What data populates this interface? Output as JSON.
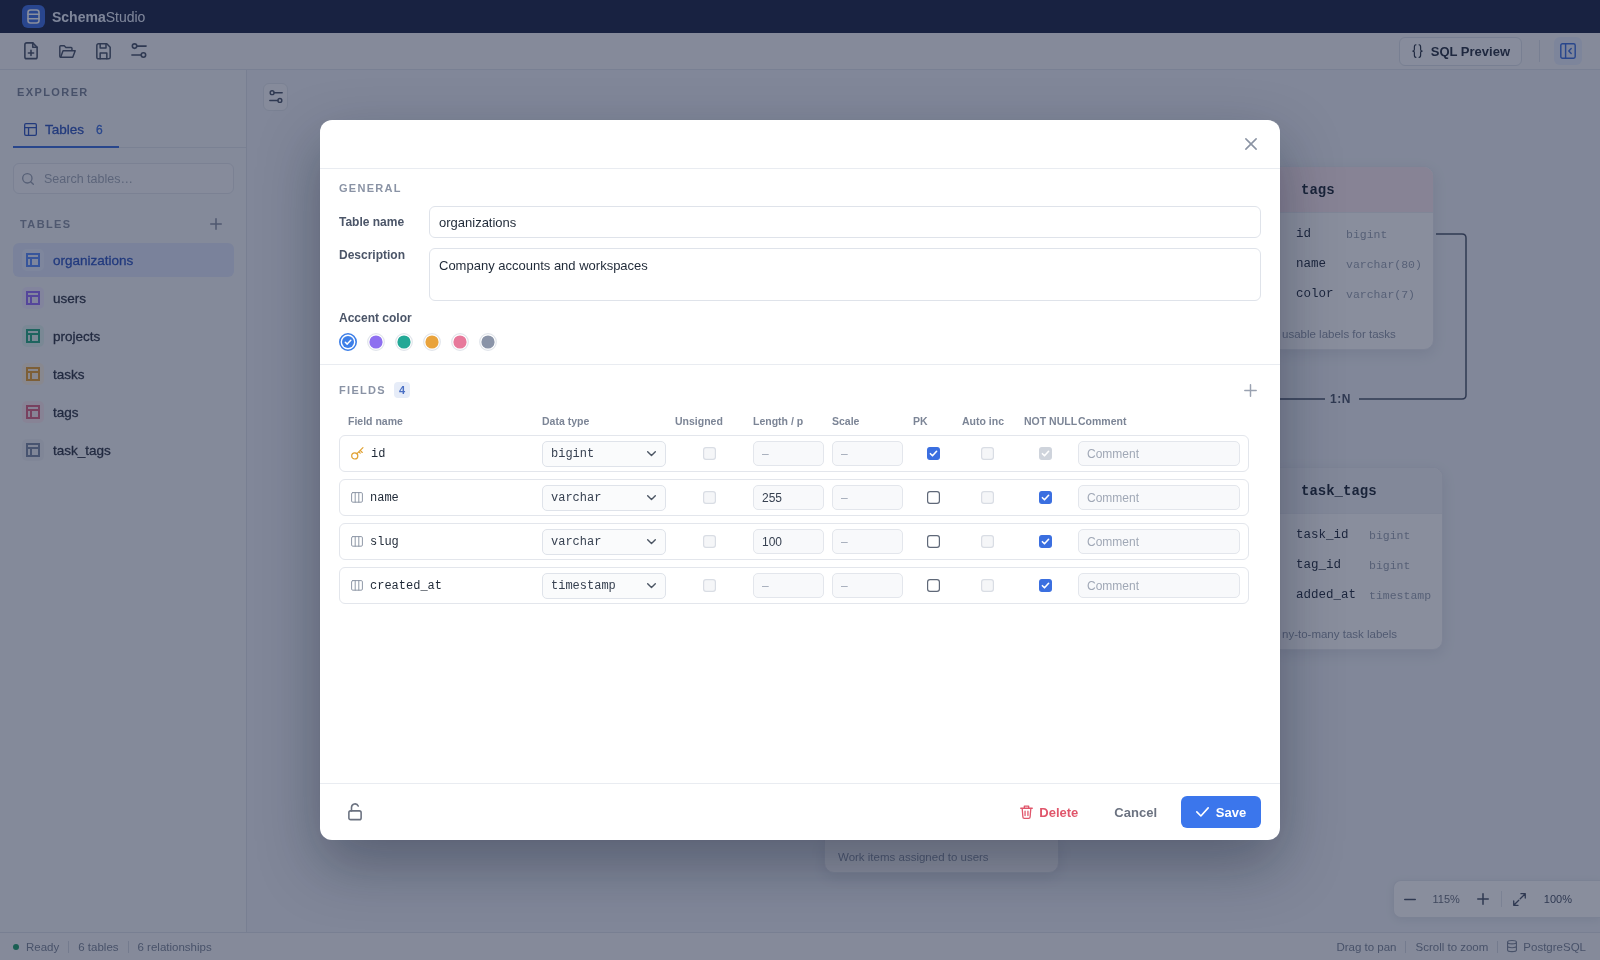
{
  "topbar": {
    "title": "**Schema**Studio"
  },
  "toolbar": {
    "sql_preview": "SQL Preview"
  },
  "sidebar": {
    "heading": "EXPLORER",
    "tabs": [
      {
        "label": "Tables",
        "count": "6",
        "selected": true
      }
    ],
    "search": {
      "placeholder": "Search tables…"
    },
    "section_title": "TABLES",
    "tables": [
      {
        "name": "organizations",
        "color": "#37559b",
        "selected": true
      },
      {
        "name": "users",
        "color": "#55469b",
        "selected": false
      },
      {
        "name": "projects",
        "color": "#1e645f",
        "selected": false
      },
      {
        "name": "tasks",
        "color": "#7d5f37",
        "selected": false
      },
      {
        "name": "tags",
        "color": "#78415f",
        "selected": false
      },
      {
        "name": "task_tags",
        "color": "#485470",
        "selected": false
      }
    ]
  },
  "canvas": {
    "cards": [
      {
        "title": "tags",
        "color": "#878395",
        "columns": [
          {
            "name": "id",
            "type": "bigint"
          },
          {
            "name": "name",
            "type": "varchar(80)"
          },
          {
            "name": "color",
            "type": "varchar(7)"
          }
        ],
        "note": "usable labels for tasks"
      },
      {
        "title": "task_tags",
        "color": "#828899",
        "columns": [
          {
            "name": "task_id",
            "type": "bigint"
          },
          {
            "name": "tag_id",
            "type": "bigint"
          },
          {
            "name": "added_at",
            "type": "timestamp"
          }
        ],
        "note": "ny-to-many task labels"
      },
      {
        "note": "Work items assigned to users"
      }
    ],
    "relations": [
      {
        "label": "1:N"
      }
    ],
    "zoom": {
      "percent": "115%",
      "reset": "100%"
    }
  },
  "modal": {
    "general_title": "GENERAL",
    "table_name": {
      "label": "Table name",
      "value": "organizations"
    },
    "description": {
      "label": "Description",
      "value": "Company accounts and workspaces"
    },
    "accent_color": {
      "label": "Accent color",
      "swatches": [
        {
          "color": "#3d7fe8",
          "selected": true
        },
        {
          "color": "#8e6ff0",
          "selected": false
        },
        {
          "color": "#23a896",
          "selected": false
        },
        {
          "color": "#e9a33c",
          "selected": false
        },
        {
          "color": "#e7799b",
          "selected": false
        },
        {
          "color": "#8a94a8",
          "selected": false
        }
      ]
    },
    "fields": {
      "title": "FIELDS",
      "count": "4",
      "columns": [
        "Field name",
        "Data type",
        "Unsigned",
        "Length / p",
        "Scale",
        "PK",
        "Auto inc",
        "NOT NULL",
        "Comment"
      ],
      "rows": [
        {
          "kind": "primary-key",
          "name": "id",
          "data_type": "bigint",
          "unsigned": {
            "checked": false,
            "disabled": true
          },
          "length": {
            "placeholder": "–"
          },
          "scale": {
            "placeholder": "–"
          },
          "pk": {
            "checked": true,
            "disabled": false
          },
          "auto_inc": {
            "checked": false,
            "disabled": true
          },
          "not_null": {
            "checked": true,
            "disabled": true
          },
          "comment": {
            "placeholder": "Comment"
          }
        },
        {
          "kind": "column",
          "name": "name",
          "data_type": "varchar",
          "unsigned": {
            "checked": false,
            "disabled": true
          },
          "length": {
            "value": "255"
          },
          "scale": {
            "placeholder": "–"
          },
          "pk": {
            "checked": false,
            "disabled": false
          },
          "auto_inc": {
            "checked": false,
            "disabled": true
          },
          "not_null": {
            "checked": true,
            "disabled": false
          },
          "comment": {
            "placeholder": "Comment"
          }
        },
        {
          "kind": "column",
          "name": "slug",
          "data_type": "varchar",
          "unsigned": {
            "checked": false,
            "disabled": true
          },
          "length": {
            "value": "100"
          },
          "scale": {
            "placeholder": "–"
          },
          "pk": {
            "checked": false,
            "disabled": false
          },
          "auto_inc": {
            "checked": false,
            "disabled": true
          },
          "not_null": {
            "checked": true,
            "disabled": false
          },
          "comment": {
            "placeholder": "Comment"
          }
        },
        {
          "kind": "column",
          "name": "created_at",
          "data_type": "timestamp",
          "unsigned": {
            "checked": false,
            "disabled": true
          },
          "length": {
            "placeholder": "–"
          },
          "scale": {
            "placeholder": "–"
          },
          "pk": {
            "checked": false,
            "disabled": false
          },
          "auto_inc": {
            "checked": false,
            "disabled": true
          },
          "not_null": {
            "checked": true,
            "disabled": false
          },
          "comment": {
            "placeholder": "Comment"
          }
        }
      ]
    },
    "footer": {
      "delete": "Delete",
      "cancel": "Cancel",
      "save": "Save"
    }
  },
  "status_bar": {
    "left": [
      {
        "kind": "status",
        "text": "Ready"
      },
      {
        "kind": "text",
        "text": "6 tables"
      },
      {
        "kind": "text",
        "text": "6 relationships"
      }
    ],
    "right": [
      {
        "kind": "text",
        "text": "Drag to pan"
      },
      {
        "kind": "text",
        "text": "Scroll to zoom"
      },
      {
        "kind": "database",
        "text": "PostgreSQL"
      }
    ]
  }
}
